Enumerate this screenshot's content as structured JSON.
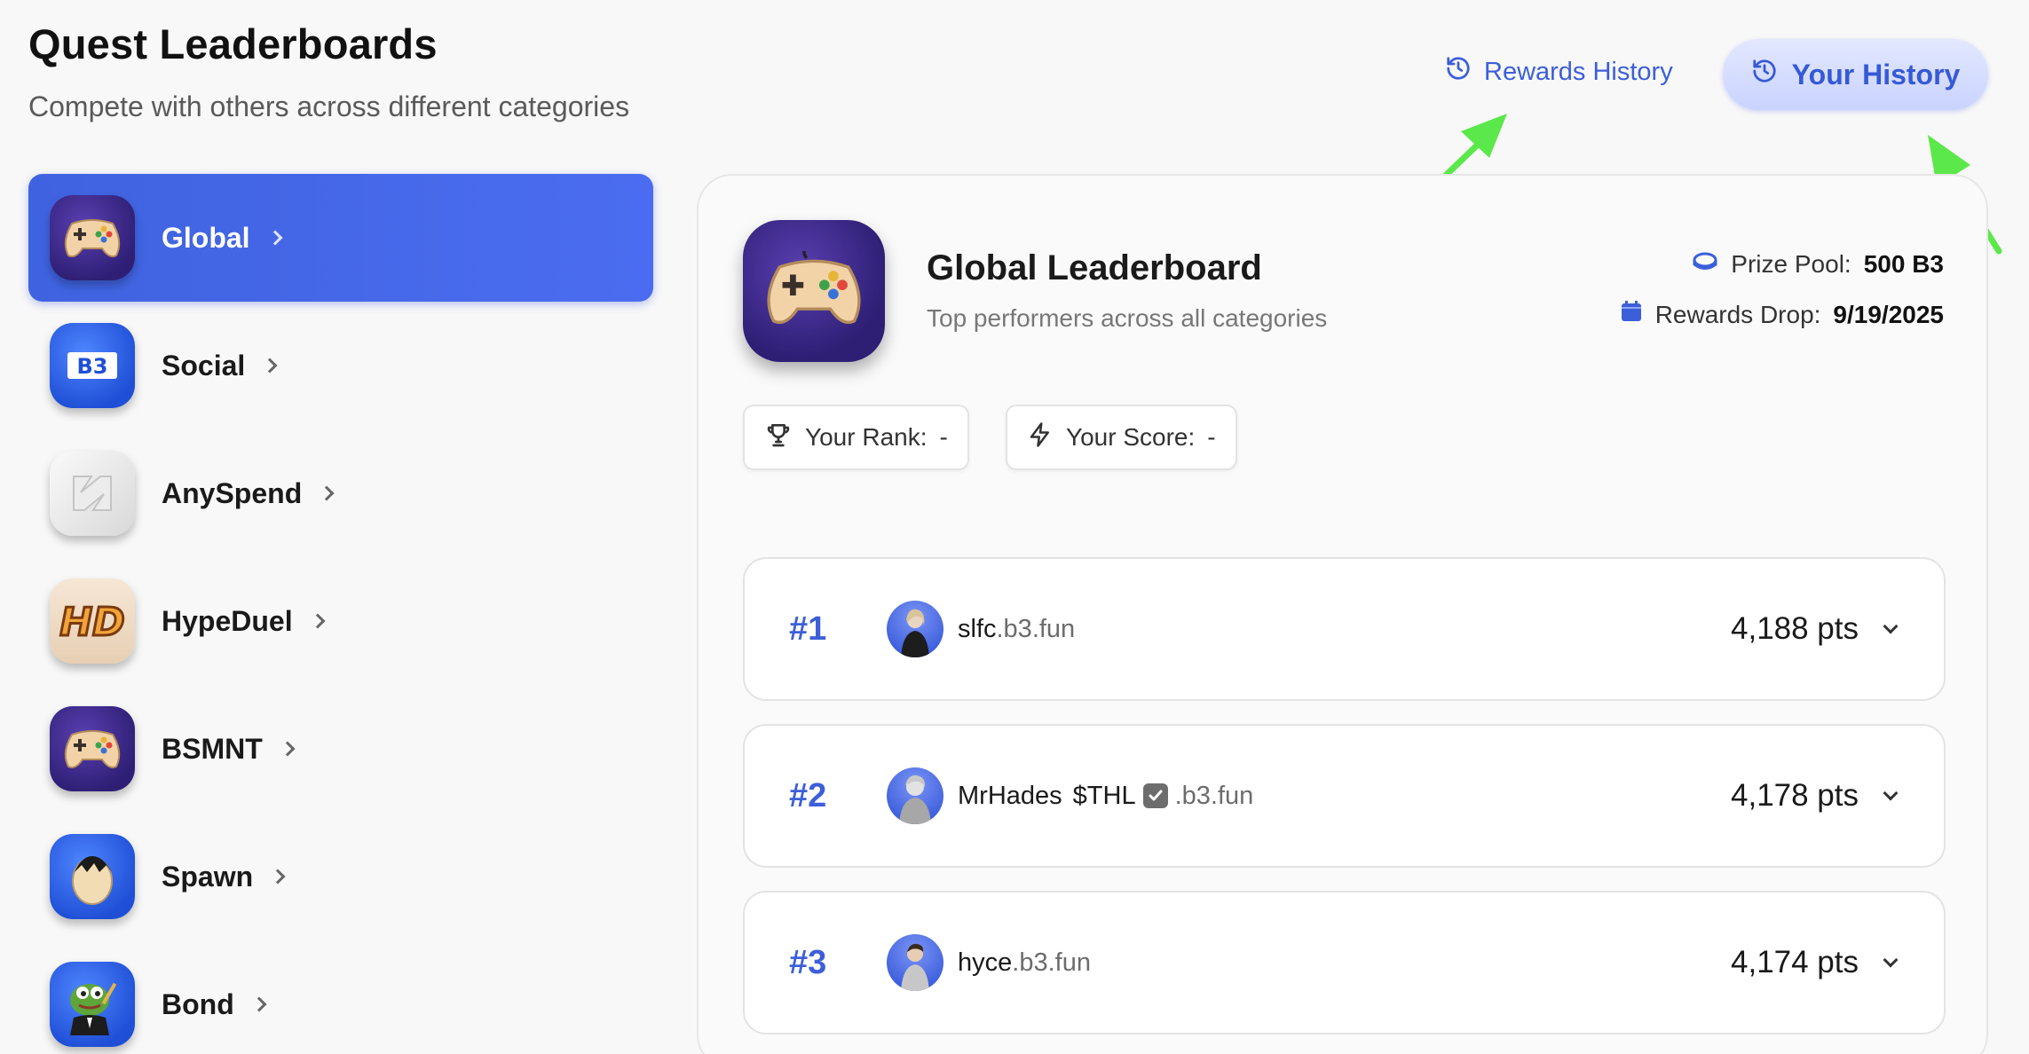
{
  "header": {
    "title": "Quest Leaderboards",
    "subtitle": "Compete with others across different categories",
    "rewards_history_label": "Rewards History",
    "your_history_label": "Your History"
  },
  "sidebar": {
    "items": [
      {
        "label": "Global",
        "icon": "gamepad-icon",
        "active": true
      },
      {
        "label": "Social",
        "icon": "b3-logo-icon",
        "active": false
      },
      {
        "label": "AnySpend",
        "icon": "anyspend-logo-icon",
        "active": false
      },
      {
        "label": "HypeDuel",
        "icon": "hd-logo-icon",
        "active": false
      },
      {
        "label": "BSMNT",
        "icon": "gamepad-icon",
        "active": false
      },
      {
        "label": "Spawn",
        "icon": "egg-icon",
        "active": false
      },
      {
        "label": "Bond",
        "icon": "frog-icon",
        "active": false
      }
    ]
  },
  "leaderboard": {
    "title": "Global Leaderboard",
    "subtitle": "Top performers across all categories",
    "prize_pool_label": "Prize Pool:",
    "prize_pool_value": "500 B3",
    "rewards_drop_label": "Rewards Drop:",
    "rewards_drop_value": "9/19/2025",
    "your_rank_label": "Your Rank:",
    "your_rank_value": "-",
    "your_score_label": "Your Score:",
    "your_score_value": "-",
    "rows": [
      {
        "rank": "#1",
        "name": "slfc",
        "badge": "",
        "domain": ".b3.fun",
        "points": "4,188 pts"
      },
      {
        "rank": "#2",
        "name": "MrHades",
        "badge": "$THL",
        "domain": ".b3.fun",
        "points": "4,178 pts"
      },
      {
        "rank": "#3",
        "name": "hyce",
        "badge": "",
        "domain": ".b3.fun",
        "points": "4,174 pts"
      }
    ]
  },
  "colors": {
    "accent": "#3f63e0",
    "rank": "#3d5fd8",
    "annotation_arrow": "#5be84a"
  }
}
